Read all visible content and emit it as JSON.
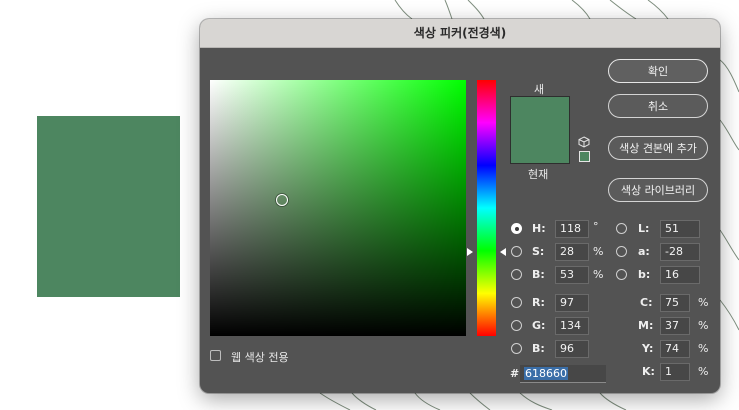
{
  "colors": {
    "current_color": "#4d8660",
    "hue_color": "#00ff00",
    "background_line": "#7f8f7f"
  },
  "dialog": {
    "title": "색상 피커(전경색)",
    "new_label": "새",
    "current_label": "현재",
    "web_only_label": "웹 색상 전용",
    "web_only_checked": false,
    "selected_mode": "H"
  },
  "buttons": {
    "ok": "확인",
    "cancel": "취소",
    "add_swatch": "색상 견본에 추가",
    "libraries": "색상 라이브러리"
  },
  "hsb": {
    "h": {
      "label": "H:",
      "value": "118",
      "unit": "°"
    },
    "s": {
      "label": "S:",
      "value": "28",
      "unit": "%"
    },
    "b": {
      "label": "B:",
      "value": "53",
      "unit": "%"
    }
  },
  "rgb": {
    "r": {
      "label": "R:",
      "value": "97"
    },
    "g": {
      "label": "G:",
      "value": "134"
    },
    "b": {
      "label": "B:",
      "value": "96"
    }
  },
  "lab": {
    "l": {
      "label": "L:",
      "value": "51"
    },
    "a": {
      "label": "a:",
      "value": "-28"
    },
    "b": {
      "label": "b:",
      "value": "16"
    }
  },
  "cmyk": {
    "c": {
      "label": "C:",
      "value": "75",
      "unit": "%"
    },
    "m": {
      "label": "M:",
      "value": "37",
      "unit": "%"
    },
    "y": {
      "label": "Y:",
      "value": "74",
      "unit": "%"
    },
    "k": {
      "label": "K:",
      "value": "1",
      "unit": "%"
    }
  },
  "hex": {
    "label": "#",
    "value": "618660"
  }
}
